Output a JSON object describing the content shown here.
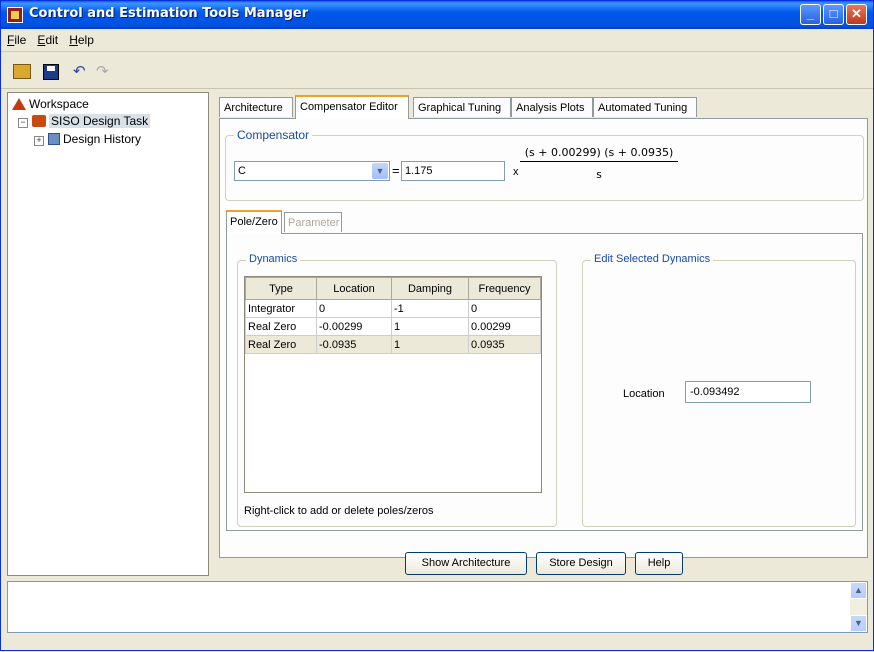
{
  "window": {
    "title": "Control and Estimation Tools Manager"
  },
  "menu": [
    {
      "label": "File"
    },
    {
      "label": "Edit"
    },
    {
      "label": "Help"
    }
  ],
  "toolbar": {
    "icons": [
      "open-folder-icon",
      "save-icon",
      "undo-icon",
      "redo-icon"
    ]
  },
  "tree": {
    "root": "Workspace",
    "task": "SISO Design Task",
    "history": "Design History"
  },
  "tabs": [
    {
      "label": "Architecture"
    },
    {
      "label": "Compensator Editor",
      "active": true
    },
    {
      "label": "Graphical Tuning"
    },
    {
      "label": "Analysis Plots"
    },
    {
      "label": "Automated Tuning"
    }
  ],
  "compensator": {
    "legend": "Compensator",
    "selected": "C",
    "equals": "=",
    "gain": "1.175",
    "times": "x",
    "numerator": "(s + 0.00299) (s + 0.0935)",
    "denominator": "s"
  },
  "subtabs": [
    {
      "label": "Pole/Zero",
      "active": true
    },
    {
      "label": "Parameter",
      "disabled": true
    }
  ],
  "dynamics": {
    "legend": "Dynamics",
    "columns": [
      "Type",
      "Location",
      "Damping",
      "Frequency"
    ],
    "rows": [
      [
        "Integrator",
        "0",
        "-1",
        "0"
      ],
      [
        "Real Zero",
        "-0.00299",
        "1",
        "0.00299"
      ],
      [
        "Real Zero",
        "-0.0935",
        "1",
        "0.0935"
      ]
    ],
    "hint": "Right-click to add or delete poles/zeros"
  },
  "edit_selected": {
    "legend": "Edit Selected Dynamics",
    "location_label": "Location",
    "location_value": "-0.093492"
  },
  "buttons": {
    "show_architecture": "Show Architecture",
    "store_design": "Store Design",
    "help": "Help"
  }
}
